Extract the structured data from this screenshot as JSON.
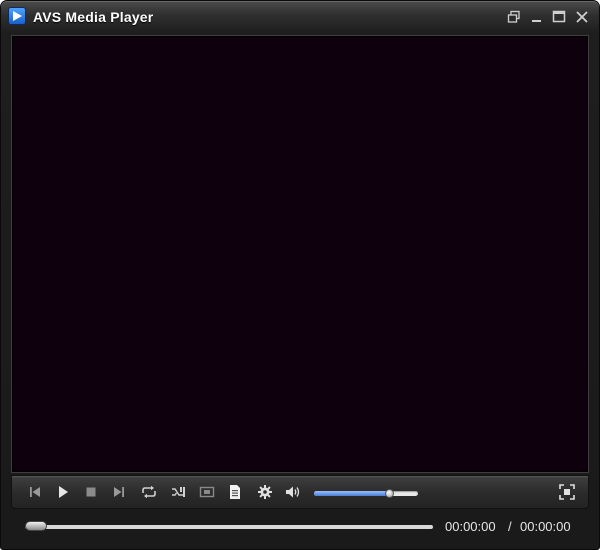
{
  "window": {
    "title": "AVS Media Player"
  },
  "titlebar_buttons": [
    {
      "icon": "restore-icon"
    },
    {
      "icon": "minimize-icon"
    },
    {
      "icon": "maximize-icon"
    },
    {
      "icon": "close-icon"
    }
  ],
  "controls": [
    {
      "icon": "previous-icon"
    },
    {
      "icon": "play-icon"
    },
    {
      "icon": "stop-icon"
    },
    {
      "icon": "next-icon"
    },
    {
      "icon": "repeat-icon"
    },
    {
      "icon": "shuffle-icon"
    },
    {
      "icon": "aspect-ratio-icon"
    },
    {
      "icon": "playlist-icon"
    },
    {
      "icon": "settings-gear-icon"
    },
    {
      "icon": "volume-icon"
    },
    {
      "icon": "fullscreen-icon"
    }
  ],
  "volume": {
    "level": 0.72
  },
  "seek": {
    "position": 0.0
  },
  "time": {
    "current": "00:00:00",
    "separator": "/",
    "total": "00:00:00"
  },
  "colors": {
    "video_bg": "#0e000c",
    "volume_fill": "#4a7fd6",
    "chrome_dark": "#1e1e1e"
  }
}
